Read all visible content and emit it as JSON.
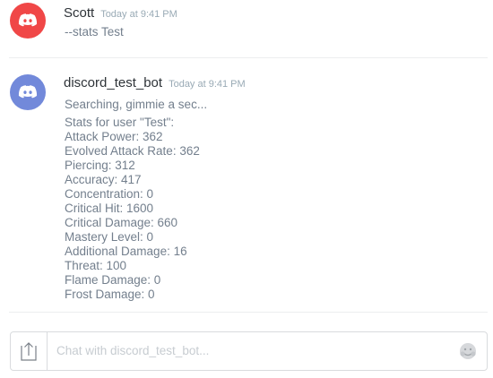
{
  "colors": {
    "scott_avatar": "#f04747",
    "bot_avatar": "#7289da",
    "username": "#2e3338",
    "timestamp": "#99aab5",
    "text": "#737f8d",
    "placeholder": "#c7ccd1"
  },
  "messages": [
    {
      "username": "Scott",
      "timestamp": "Today at 9:41 PM",
      "avatar_icon": "discord-logo-icon",
      "lines": [
        "--stats Test"
      ]
    },
    {
      "username": "discord_test_bot",
      "timestamp": "Today at 9:41 PM",
      "avatar_icon": "discord-logo-icon",
      "lines": [
        "Searching, gimmie a sec...",
        "Stats for user \"Test\":",
        "Attack Power: 362",
        "Evolved Attack Rate: 362",
        "Piercing: 312",
        "Accuracy: 417",
        "Concentration: 0",
        "Critical Hit: 1600",
        "Critical Damage: 660",
        "Mastery Level: 0",
        "Additional Damage: 16",
        "Threat: 100",
        "Flame Damage: 0",
        "Frost Damage: 0"
      ]
    }
  ],
  "chat_input": {
    "placeholder": "Chat with discord_test_bot...",
    "upload_icon": "upload-icon",
    "emoji_icon": "emoji-icon"
  }
}
